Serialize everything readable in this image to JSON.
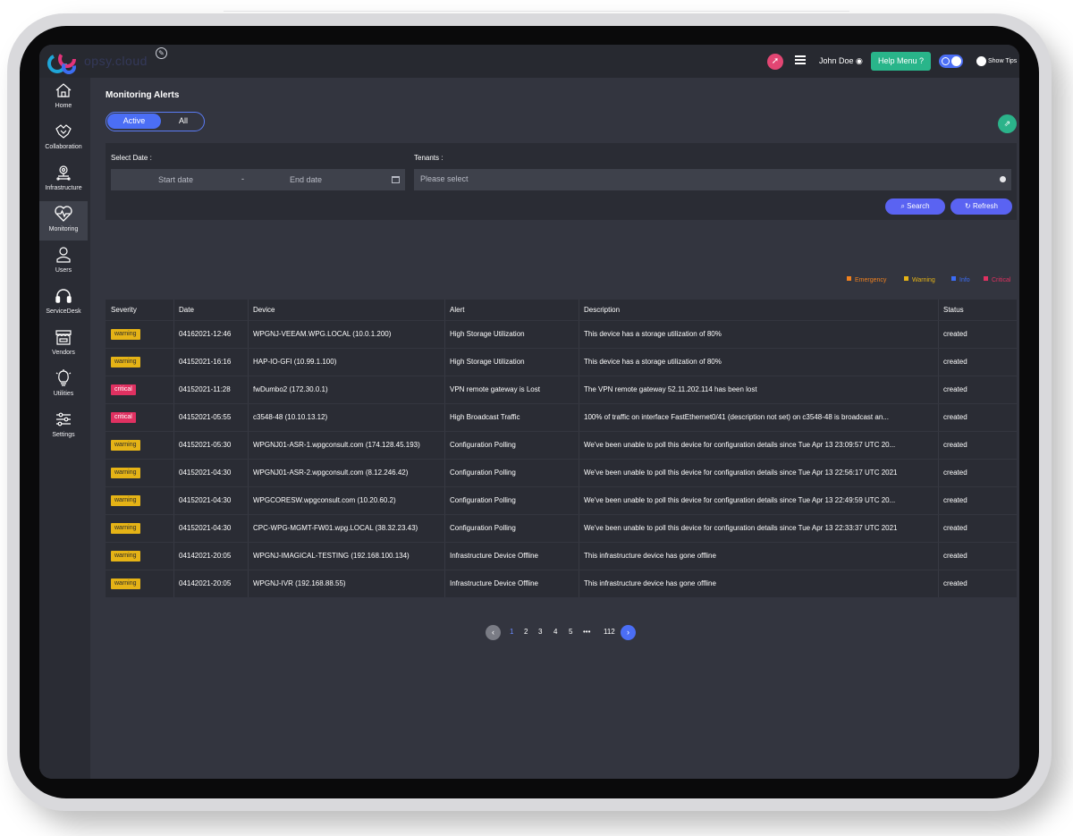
{
  "brand": {
    "name": "opsy.cloud"
  },
  "topbar": {
    "user_name": "John Doe",
    "help_label": "Help Menu ?",
    "tips_label": "Show Tips"
  },
  "sidebar": {
    "items": [
      {
        "label": "Home",
        "icon": "home-icon"
      },
      {
        "label": "Collaboration",
        "icon": "collaboration-icon"
      },
      {
        "label": "Infrastructure",
        "icon": "infrastructure-icon"
      },
      {
        "label": "Monitoring",
        "icon": "monitoring-icon",
        "active": true
      },
      {
        "label": "Users",
        "icon": "users-icon"
      },
      {
        "label": "ServiceDesk",
        "icon": "headset-icon"
      },
      {
        "label": "Vendors",
        "icon": "store-icon"
      },
      {
        "label": "Utilities",
        "icon": "lightbulb-icon"
      },
      {
        "label": "Settings",
        "icon": "sliders-icon"
      }
    ]
  },
  "page": {
    "title": "Monitoring Alerts",
    "tabs": {
      "active": "Active",
      "all": "All"
    }
  },
  "filters": {
    "date_label": "Select Date :",
    "start_placeholder": "Start date",
    "separator": "-",
    "end_placeholder": "End date",
    "tenants_label": "Tenants :",
    "tenants_placeholder": "Please select",
    "search_label": "Search",
    "refresh_label": "Refresh"
  },
  "legend": [
    {
      "label": "Emergency",
      "color": "#f0811f"
    },
    {
      "label": "Warning",
      "color": "#e5b316"
    },
    {
      "label": "Info",
      "color": "#3b6cf6"
    },
    {
      "label": "Critical",
      "color": "#e03161"
    }
  ],
  "table": {
    "columns": [
      "Severity",
      "Date",
      "Device",
      "Alert",
      "Description",
      "Status"
    ],
    "rows": [
      {
        "severity": "warning",
        "date": "04162021-12:46",
        "device": "WPGNJ-VEEAM.WPG.LOCAL (10.0.1.200)",
        "alert": "High Storage Utilization",
        "description": "This device has a storage utilization of 80%",
        "status": "created"
      },
      {
        "severity": "warning",
        "date": "04152021-16:16",
        "device": "HAP-IO-GFI (10.99.1.100)",
        "alert": "High Storage Utilization",
        "description": "This device has a storage utilization of 80%",
        "status": "created"
      },
      {
        "severity": "critical",
        "date": "04152021-11:28",
        "device": "fwDumbo2 (172.30.0.1)",
        "alert": "VPN remote gateway is Lost",
        "description": "The VPN remote gateway 52.11.202.114 has been lost",
        "status": "created"
      },
      {
        "severity": "critical",
        "date": "04152021-05:55",
        "device": "c3548-48 (10.10.13.12)",
        "alert": "High Broadcast Traffic",
        "description": "100% of traffic on interface FastEthernet0/41 (description not set) on c3548-48 is broadcast an...",
        "status": "created"
      },
      {
        "severity": "warning",
        "date": "04152021-05:30",
        "device": "WPGNJ01-ASR-1.wpgconsult.com (174.128.45.193)",
        "alert": "Configuration Polling",
        "description": "We've been unable to poll this device for configuration details since Tue Apr 13 23:09:57 UTC 20...",
        "status": "created"
      },
      {
        "severity": "warning",
        "date": "04152021-04:30",
        "device": "WPGNJ01-ASR-2.wpgconsult.com (8.12.246.42)",
        "alert": "Configuration Polling",
        "description": "We've been unable to poll this device for configuration details since Tue Apr 13 22:56:17 UTC 2021",
        "status": "created"
      },
      {
        "severity": "warning",
        "date": "04152021-04:30",
        "device": "WPGCORESW.wpgconsult.com (10.20.60.2)",
        "alert": "Configuration Polling",
        "description": "We've been unable to poll this device for configuration details since Tue Apr 13 22:49:59 UTC 20...",
        "status": "created"
      },
      {
        "severity": "warning",
        "date": "04152021-04:30",
        "device": "CPC-WPG-MGMT-FW01.wpg.LOCAL (38.32.23.43)",
        "alert": "Configuration Polling",
        "description": "We've been unable to poll this device for configuration details since Tue Apr 13 22:33:37 UTC 2021",
        "status": "created"
      },
      {
        "severity": "warning",
        "date": "04142021-20:05",
        "device": "WPGNJ-IMAGICAL-TESTING (192.168.100.134)",
        "alert": "Infrastructure Device Offline",
        "description": "This infrastructure device has gone offline",
        "status": "created"
      },
      {
        "severity": "warning",
        "date": "04142021-20:05",
        "device": "WPGNJ-IVR (192.168.88.55)",
        "alert": "Infrastructure Device Offline",
        "description": "This infrastructure device has gone offline",
        "status": "created"
      }
    ]
  },
  "pagination": {
    "pages": [
      "1",
      "2",
      "3",
      "4",
      "5",
      "•••",
      "112"
    ],
    "current": "1"
  }
}
